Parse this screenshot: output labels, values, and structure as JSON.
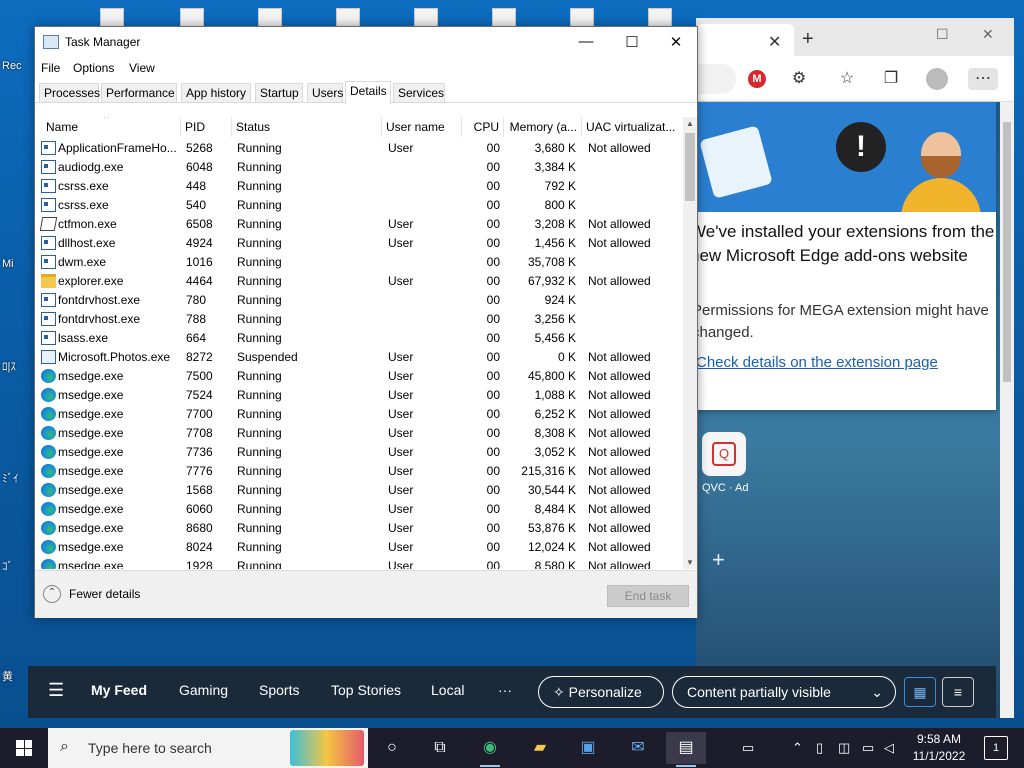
{
  "desktop": {
    "left_labels": [
      "Rec",
      "Mi",
      "ﾛ|ｽ",
      "ﾐﾞｲ",
      "ｺﾞ",
      "黄"
    ]
  },
  "edge": {
    "tab_close": "✕",
    "new_tab": "+",
    "popup": {
      "title": "We've installed your extensions from the new Microsoft Edge add-ons website",
      "text": "Permissions for MEGA extension might have changed.",
      "link": "Check details on the extension page"
    },
    "qvc_label": "QVC · Ad",
    "feed": {
      "items": [
        "My Feed",
        "Gaming",
        "Sports",
        "Top Stories",
        "Local"
      ],
      "more": "···",
      "personalize": "Personalize",
      "content_select": "Content partially visible"
    }
  },
  "task_manager": {
    "title": "Task Manager",
    "menu": [
      "File",
      "Options",
      "View"
    ],
    "tabs": [
      "Processes",
      "Performance",
      "App history",
      "Startup",
      "Users",
      "Details",
      "Services"
    ],
    "active_tab": "Details",
    "columns": [
      "Name",
      "PID",
      "Status",
      "User name",
      "CPU",
      "Memory (a...",
      "UAC virtualizat..."
    ],
    "rows": [
      {
        "icon": "app",
        "name": "ApplicationFrameHo...",
        "pid": "5268",
        "status": "Running",
        "user": "User",
        "cpu": "00",
        "mem": "3,680 K",
        "uac": "Not allowed"
      },
      {
        "icon": "app",
        "name": "audiodg.exe",
        "pid": "6048",
        "status": "Running",
        "user": "",
        "cpu": "00",
        "mem": "3,384 K",
        "uac": ""
      },
      {
        "icon": "app",
        "name": "csrss.exe",
        "pid": "448",
        "status": "Running",
        "user": "",
        "cpu": "00",
        "mem": "792 K",
        "uac": ""
      },
      {
        "icon": "app",
        "name": "csrss.exe",
        "pid": "540",
        "status": "Running",
        "user": "",
        "cpu": "00",
        "mem": "800 K",
        "uac": ""
      },
      {
        "icon": "pen",
        "name": "ctfmon.exe",
        "pid": "6508",
        "status": "Running",
        "user": "User",
        "cpu": "00",
        "mem": "3,208 K",
        "uac": "Not allowed"
      },
      {
        "icon": "app",
        "name": "dllhost.exe",
        "pid": "4924",
        "status": "Running",
        "user": "User",
        "cpu": "00",
        "mem": "1,456 K",
        "uac": "Not allowed"
      },
      {
        "icon": "app",
        "name": "dwm.exe",
        "pid": "1016",
        "status": "Running",
        "user": "",
        "cpu": "00",
        "mem": "35,708 K",
        "uac": ""
      },
      {
        "icon": "folder",
        "name": "explorer.exe",
        "pid": "4464",
        "status": "Running",
        "user": "User",
        "cpu": "00",
        "mem": "67,932 K",
        "uac": "Not allowed"
      },
      {
        "icon": "app",
        "name": "fontdrvhost.exe",
        "pid": "780",
        "status": "Running",
        "user": "",
        "cpu": "00",
        "mem": "924 K",
        "uac": ""
      },
      {
        "icon": "app",
        "name": "fontdrvhost.exe",
        "pid": "788",
        "status": "Running",
        "user": "",
        "cpu": "00",
        "mem": "3,256 K",
        "uac": ""
      },
      {
        "icon": "app",
        "name": "lsass.exe",
        "pid": "664",
        "status": "Running",
        "user": "",
        "cpu": "00",
        "mem": "5,456 K",
        "uac": ""
      },
      {
        "icon": "photo",
        "name": "Microsoft.Photos.exe",
        "pid": "8272",
        "status": "Suspended",
        "user": "User",
        "cpu": "00",
        "mem": "0 K",
        "uac": "Not allowed"
      },
      {
        "icon": "edge",
        "name": "msedge.exe",
        "pid": "7500",
        "status": "Running",
        "user": "User",
        "cpu": "00",
        "mem": "45,800 K",
        "uac": "Not allowed"
      },
      {
        "icon": "edge",
        "name": "msedge.exe",
        "pid": "7524",
        "status": "Running",
        "user": "User",
        "cpu": "00",
        "mem": "1,088 K",
        "uac": "Not allowed"
      },
      {
        "icon": "edge",
        "name": "msedge.exe",
        "pid": "7700",
        "status": "Running",
        "user": "User",
        "cpu": "00",
        "mem": "6,252 K",
        "uac": "Not allowed"
      },
      {
        "icon": "edge",
        "name": "msedge.exe",
        "pid": "7708",
        "status": "Running",
        "user": "User",
        "cpu": "00",
        "mem": "8,308 K",
        "uac": "Not allowed"
      },
      {
        "icon": "edge",
        "name": "msedge.exe",
        "pid": "7736",
        "status": "Running",
        "user": "User",
        "cpu": "00",
        "mem": "3,052 K",
        "uac": "Not allowed"
      },
      {
        "icon": "edge",
        "name": "msedge.exe",
        "pid": "7776",
        "status": "Running",
        "user": "User",
        "cpu": "00",
        "mem": "215,316 K",
        "uac": "Not allowed"
      },
      {
        "icon": "edge",
        "name": "msedge.exe",
        "pid": "1568",
        "status": "Running",
        "user": "User",
        "cpu": "00",
        "mem": "30,544 K",
        "uac": "Not allowed"
      },
      {
        "icon": "edge",
        "name": "msedge.exe",
        "pid": "6060",
        "status": "Running",
        "user": "User",
        "cpu": "00",
        "mem": "8,484 K",
        "uac": "Not allowed"
      },
      {
        "icon": "edge",
        "name": "msedge.exe",
        "pid": "8680",
        "status": "Running",
        "user": "User",
        "cpu": "00",
        "mem": "53,876 K",
        "uac": "Not allowed"
      },
      {
        "icon": "edge",
        "name": "msedge.exe",
        "pid": "8024",
        "status": "Running",
        "user": "User",
        "cpu": "00",
        "mem": "12,024 K",
        "uac": "Not allowed"
      },
      {
        "icon": "edge",
        "name": "msedge.exe",
        "pid": "1928",
        "status": "Running",
        "user": "User",
        "cpu": "00",
        "mem": "8,580 K",
        "uac": "Not allowed"
      }
    ],
    "footer": {
      "fewer_details": "Fewer details",
      "end_task": "End task"
    }
  },
  "taskbar": {
    "search_placeholder": "Type here to search",
    "time": "9:58 AM",
    "date": "11/1/2022",
    "notifications_count": "1"
  }
}
